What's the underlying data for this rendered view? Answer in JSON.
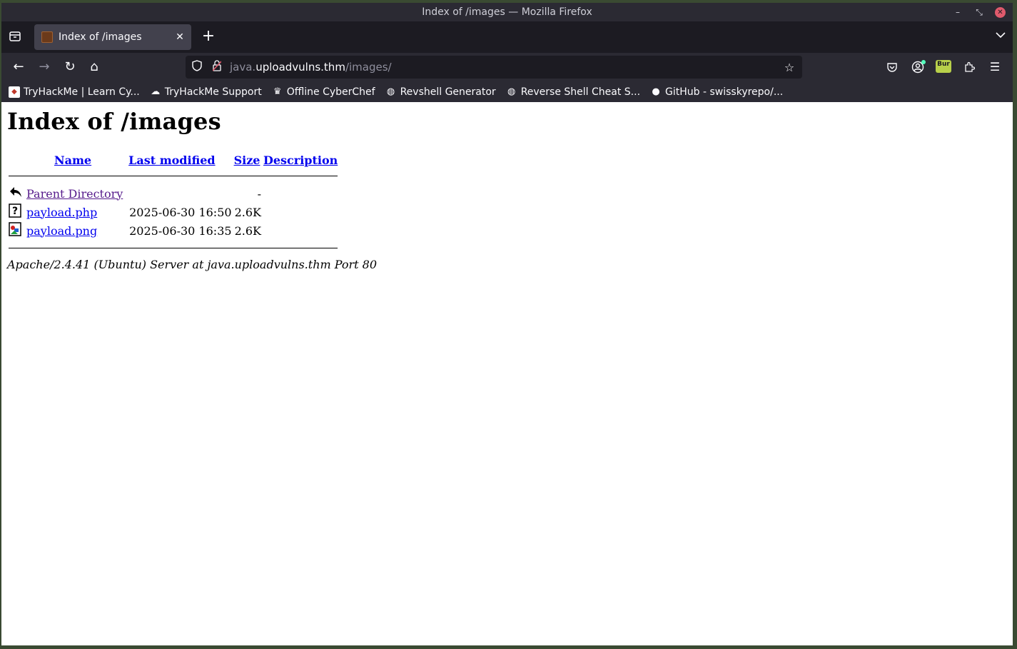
{
  "window": {
    "title": "Index of /images — Mozilla Firefox",
    "controls": {
      "minimize": "–",
      "maximize": "⤡",
      "close": "✕"
    }
  },
  "tabs": [
    {
      "title": "Index of /images",
      "close": "✕"
    }
  ],
  "toolbar": {
    "new_tab": "+",
    "back": "←",
    "forward": "→",
    "reload": "↻",
    "home": "⌂",
    "url_subdomain": "java.",
    "url_host": "uploadvulns.thm",
    "url_path": "/images/",
    "burp_badge": "Bur"
  },
  "bookmarks": [
    {
      "label": "TryHackMe | Learn Cy...",
      "icon": "tryhackme-icon"
    },
    {
      "label": "TryHackMe Support",
      "icon": "cloud-icon"
    },
    {
      "label": "Offline CyberChef",
      "icon": "chef-hat-icon"
    },
    {
      "label": "Revshell Generator",
      "icon": "globe-icon"
    },
    {
      "label": "Reverse Shell Cheat S...",
      "icon": "globe-icon"
    },
    {
      "label": "GitHub - swisskyrepo/...",
      "icon": "github-icon"
    }
  ],
  "page": {
    "heading": "Index of /images",
    "columns": {
      "name": "Name",
      "modified": "Last modified",
      "size": "Size",
      "description": "Description"
    },
    "rows": [
      {
        "name": "Parent Directory",
        "modified": "",
        "size": "-",
        "description": "",
        "icon": "back-arrow-icon"
      },
      {
        "name": "payload.php",
        "modified": "2025-06-30 16:50",
        "size": "2.6K",
        "description": "",
        "icon": "unknown-file-icon"
      },
      {
        "name": "payload.png",
        "modified": "2025-06-30 16:35",
        "size": "2.6K",
        "description": "",
        "icon": "image-file-icon"
      }
    ],
    "footer": "Apache/2.4.41 (Ubuntu) Server at java.uploadvulns.thm Port 80"
  }
}
